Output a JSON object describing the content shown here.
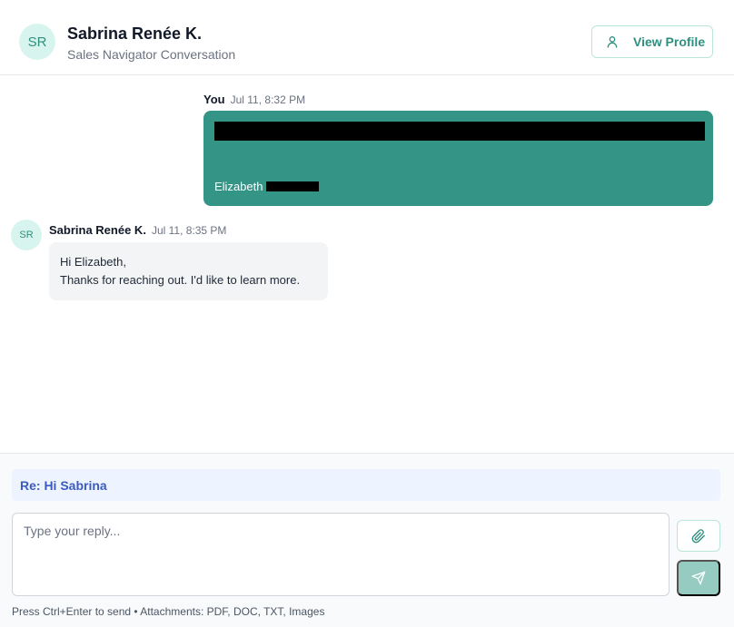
{
  "header": {
    "avatar_initials": "SR",
    "name": "Sabrina Renée K.",
    "subtitle": "Sales Navigator Conversation",
    "view_profile_label": "View Profile",
    "view_profile_icon": "user-icon"
  },
  "messages": [
    {
      "sender": "You",
      "timestamp": "Jul 11, 8:32 PM",
      "signature": "Elizabeth",
      "redacted": true
    },
    {
      "sender": "Sabrina Renée K.",
      "avatar_initials": "SR",
      "timestamp": "Jul 11, 8:35 PM",
      "lines": [
        "Hi Elizabeth,",
        "Thanks for reaching out. I'd like to learn more."
      ]
    }
  ],
  "composer": {
    "subject": "Re: Hi Sabrina",
    "placeholder": "Type your reply...",
    "value": "",
    "attach_icon": "paperclip-icon",
    "send_icon": "send-icon",
    "hint": "Press Ctrl+Enter to send • Attachments: PDF, DOC, TXT, Images"
  },
  "colors": {
    "accent": "#349587",
    "accent_light": "#96cbc1",
    "avatar_bg": "#d7f5ee",
    "subject_bg": "#eef4ff",
    "subject_text": "#3b5bbf"
  }
}
